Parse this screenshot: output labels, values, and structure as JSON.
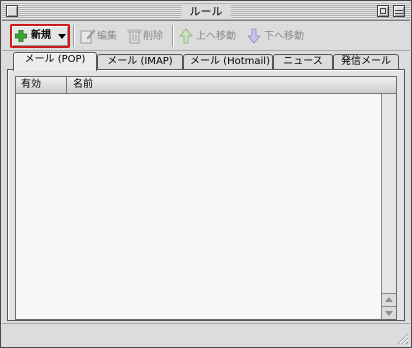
{
  "window": {
    "title": "ルール"
  },
  "toolbar": {
    "new_label": "新規",
    "edit_label": "編集",
    "delete_label": "削除",
    "move_up_label": "上へ移動",
    "move_down_label": "下へ移動"
  },
  "tabs": [
    {
      "label": "メール (POP)",
      "active": true
    },
    {
      "label": "メール (IMAP)",
      "active": false
    },
    {
      "label": "メール (Hotmail)",
      "active": false
    },
    {
      "label": "ニュース",
      "active": false
    },
    {
      "label": "発信メール",
      "active": false
    }
  ],
  "list": {
    "columns": [
      "有効",
      "名前"
    ],
    "rows": []
  },
  "colors": {
    "highlight_border": "#cc1a1a",
    "add_icon": "#3aa63a",
    "disabled_text": "#8a8a8a"
  },
  "icons": {
    "new": "plus-icon",
    "edit": "edit-icon",
    "delete": "trash-icon",
    "move_up": "arrow-up-icon",
    "move_down": "arrow-down-icon"
  }
}
